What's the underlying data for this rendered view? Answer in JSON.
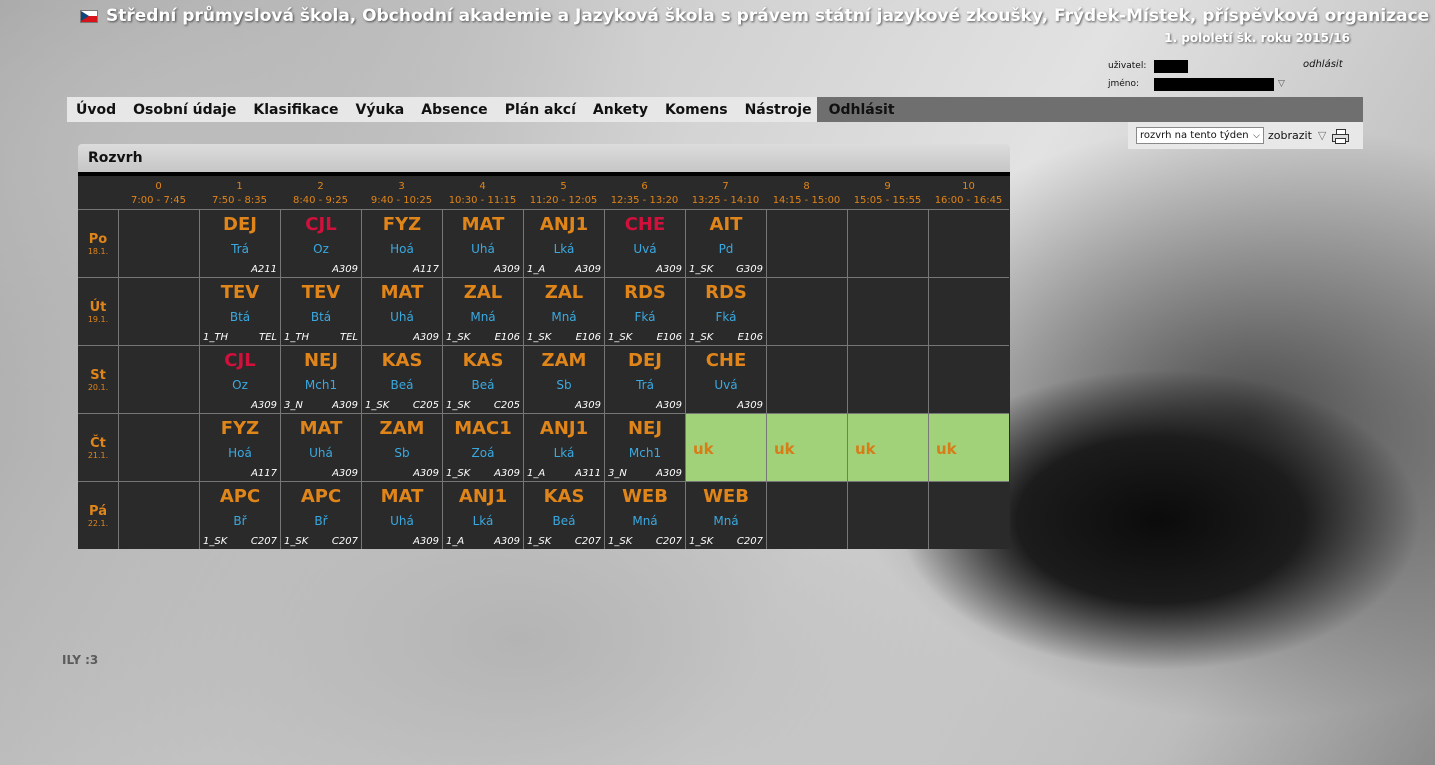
{
  "header": {
    "title": "Střední průmyslová škola, Obchodní akademie a Jazyková škola s právem státní jazykové zkoušky, Frýdek-Místek, příspěvková organizace",
    "subtitle": "1. pololetí šk. roku 2015/16",
    "user_label": "uživatel:",
    "name_label": "jméno:",
    "logout": "odhlásit"
  },
  "nav": {
    "items": [
      "Úvod",
      "Osobní údaje",
      "Klasifikace",
      "Výuka",
      "Absence",
      "Plán akcí",
      "Ankety",
      "Komens",
      "Nástroje",
      "Odhlásit"
    ]
  },
  "toolbar": {
    "select_value": "rozvrh na tento týden",
    "show_button": "zobrazit"
  },
  "panel": {
    "title": "Rozvrh"
  },
  "timetable": {
    "periods": [
      {
        "num": "0",
        "time": "7:00 - 7:45"
      },
      {
        "num": "1",
        "time": "7:50 - 8:35"
      },
      {
        "num": "2",
        "time": "8:40 - 9:25"
      },
      {
        "num": "3",
        "time": "9:40 - 10:25"
      },
      {
        "num": "4",
        "time": "10:30 - 11:15"
      },
      {
        "num": "5",
        "time": "11:20 - 12:05"
      },
      {
        "num": "6",
        "time": "12:35 - 13:20"
      },
      {
        "num": "7",
        "time": "13:25 - 14:10"
      },
      {
        "num": "8",
        "time": "14:15 - 15:00"
      },
      {
        "num": "9",
        "time": "15:05 - 15:55"
      },
      {
        "num": "10",
        "time": "16:00 - 16:45"
      }
    ],
    "days": [
      {
        "day": "Po",
        "date": "18.1.",
        "cells": [
          null,
          {
            "subj": "DEJ",
            "teacher": "Trá",
            "group": "",
            "room": "A211"
          },
          {
            "subj": "CJL",
            "red": true,
            "teacher": "Oz",
            "group": "",
            "room": "A309"
          },
          {
            "subj": "FYZ",
            "teacher": "Hoá",
            "group": "",
            "room": "A117"
          },
          {
            "subj": "MAT",
            "teacher": "Uhá",
            "group": "",
            "room": "A309"
          },
          {
            "subj": "ANJ1",
            "teacher": "Lká",
            "group": "1_A",
            "room": "A309"
          },
          {
            "subj": "CHE",
            "red": true,
            "teacher": "Uvá",
            "group": "",
            "room": "A309"
          },
          {
            "subj": "AIT",
            "teacher": "Pd",
            "group": "1_SK",
            "room": "G309"
          },
          null,
          null,
          null
        ]
      },
      {
        "day": "Út",
        "date": "19.1.",
        "cells": [
          null,
          {
            "subj": "TEV",
            "teacher": "Btá",
            "group": "1_TH",
            "room": "TEL"
          },
          {
            "subj": "TEV",
            "teacher": "Btá",
            "group": "1_TH",
            "room": "TEL"
          },
          {
            "subj": "MAT",
            "teacher": "Uhá",
            "group": "",
            "room": "A309"
          },
          {
            "subj": "ZAL",
            "teacher": "Mná",
            "group": "1_SK",
            "room": "E106"
          },
          {
            "subj": "ZAL",
            "teacher": "Mná",
            "group": "1_SK",
            "room": "E106"
          },
          {
            "subj": "RDS",
            "teacher": "Fká",
            "group": "1_SK",
            "room": "E106"
          },
          {
            "subj": "RDS",
            "teacher": "Fká",
            "group": "1_SK",
            "room": "E106"
          },
          null,
          null,
          null
        ]
      },
      {
        "day": "St",
        "date": "20.1.",
        "cells": [
          null,
          {
            "subj": "CJL",
            "red": true,
            "teacher": "Oz",
            "group": "",
            "room": "A309"
          },
          {
            "subj": "NEJ",
            "teacher": "Mch1",
            "group": "3_N",
            "room": "A309"
          },
          {
            "subj": "KAS",
            "teacher": "Beá",
            "group": "1_SK",
            "room": "C205"
          },
          {
            "subj": "KAS",
            "teacher": "Beá",
            "group": "1_SK",
            "room": "C205"
          },
          {
            "subj": "ZAM",
            "teacher": "Sb",
            "group": "",
            "room": "A309"
          },
          {
            "subj": "DEJ",
            "teacher": "Trá",
            "group": "",
            "room": "A309"
          },
          {
            "subj": "CHE",
            "teacher": "Uvá",
            "group": "",
            "room": "A309"
          },
          null,
          null,
          null
        ]
      },
      {
        "day": "Čt",
        "date": "21.1.",
        "cells": [
          null,
          {
            "subj": "FYZ",
            "teacher": "Hoá",
            "group": "",
            "room": "A117"
          },
          {
            "subj": "MAT",
            "teacher": "Uhá",
            "group": "",
            "room": "A309"
          },
          {
            "subj": "ZAM",
            "teacher": "Sb",
            "group": "",
            "room": "A309"
          },
          {
            "subj": "MAC1",
            "teacher": "Zoá",
            "group": "1_SK",
            "room": "A309"
          },
          {
            "subj": "ANJ1",
            "teacher": "Lká",
            "group": "1_A",
            "room": "A311"
          },
          {
            "subj": "NEJ",
            "teacher": "Mch1",
            "group": "3_N",
            "room": "A309"
          },
          {
            "uk": "uk"
          },
          {
            "uk": "uk"
          },
          {
            "uk": "uk"
          },
          {
            "uk": "uk"
          }
        ]
      },
      {
        "day": "Pá",
        "date": "22.1.",
        "cells": [
          null,
          {
            "subj": "APC",
            "teacher": "Bř",
            "group": "1_SK",
            "room": "C207"
          },
          {
            "subj": "APC",
            "teacher": "Bř",
            "group": "1_SK",
            "room": "C207"
          },
          {
            "subj": "MAT",
            "teacher": "Uhá",
            "group": "",
            "room": "A309"
          },
          {
            "subj": "ANJ1",
            "teacher": "Lká",
            "group": "1_A",
            "room": "A309"
          },
          {
            "subj": "KAS",
            "teacher": "Beá",
            "group": "1_SK",
            "room": "C207"
          },
          {
            "subj": "WEB",
            "teacher": "Mná",
            "group": "1_SK",
            "room": "C207"
          },
          {
            "subj": "WEB",
            "teacher": "Mná",
            "group": "1_SK",
            "room": "C207"
          },
          null,
          null,
          null
        ]
      }
    ]
  },
  "footer": {
    "note": "ILY :3"
  },
  "colors": {
    "subject": "#e0851a",
    "subject_red": "#d1103c",
    "teacher": "#3aa9e0",
    "uk_bg": "#a1d27a",
    "grid_bg": "#2a2a2a"
  }
}
